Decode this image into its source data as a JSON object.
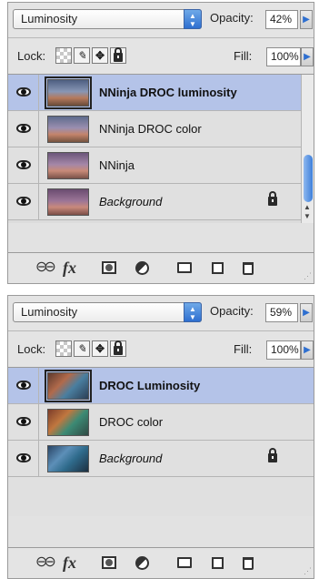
{
  "panel1": {
    "blend_mode": "Luminosity",
    "opacity_label": "Opacity:",
    "opacity_value": "42%",
    "lock_label": "Lock:",
    "fill_label": "Fill:",
    "fill_value": "100%",
    "layers": [
      {
        "name": "NNinja DROC luminosity",
        "selected": true
      },
      {
        "name": "NNinja DROC color",
        "selected": false
      },
      {
        "name": "NNinja",
        "selected": false
      },
      {
        "name": "Background",
        "selected": false,
        "locked": true
      }
    ]
  },
  "panel2": {
    "blend_mode": "Luminosity",
    "opacity_label": "Opacity:",
    "opacity_value": "59%",
    "lock_label": "Lock:",
    "fill_label": "Fill:",
    "fill_value": "100%",
    "layers": [
      {
        "name": "DROC Luminosity",
        "selected": true
      },
      {
        "name": "DROC color",
        "selected": false
      },
      {
        "name": "Background",
        "selected": false,
        "locked": true
      }
    ]
  },
  "icons": {
    "eye": "eye-icon",
    "lock": "lock-icon",
    "link": "link-layers-icon",
    "fx": "layer-style-icon",
    "mask": "add-mask-icon",
    "adjustment": "adjustment-layer-icon",
    "group": "folder-icon",
    "new_layer": "new-layer-icon",
    "trash": "trash-icon"
  },
  "bottombar": {
    "link_glyph": "⊖⊖",
    "fx_label": "fx"
  },
  "lock_glyphs": {
    "paint": "✎",
    "move": "✥",
    "all": "🔒"
  },
  "colors": {
    "selected_row": "#b4c3e8",
    "panel_bg": "#e2e2e2",
    "accent_blue": "#2e6fd0"
  }
}
